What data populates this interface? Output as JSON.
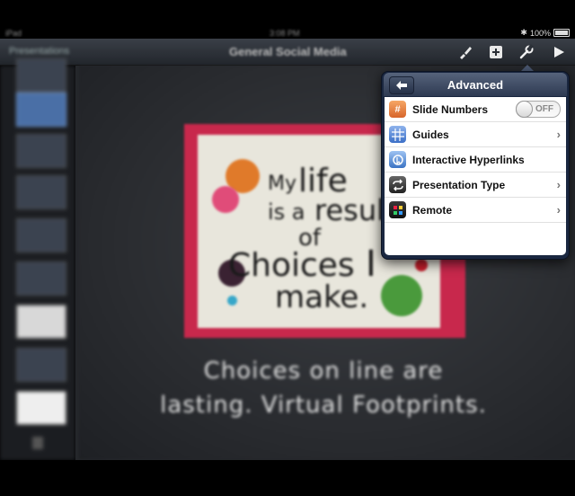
{
  "status_bar": {
    "carrier": "iPad",
    "time": "3:08 PM",
    "battery": "100%"
  },
  "toolbar": {
    "left_label": "Presentations",
    "title": "General Social Media"
  },
  "slide": {
    "quote_lines": [
      "My",
      "life",
      "is a",
      "result",
      "of",
      "Choices",
      "I",
      "make."
    ],
    "caption_line1": "Choices on line are",
    "caption_line2": "lasting. Virtual Footprints."
  },
  "popover": {
    "title": "Advanced",
    "rows": [
      {
        "label": "Slide Numbers",
        "icon": "slide-numbers-icon",
        "toggle": "OFF"
      },
      {
        "label": "Guides",
        "icon": "guides-icon"
      },
      {
        "label": "Interactive Hyperlinks",
        "icon": "hyperlink-icon"
      },
      {
        "label": "Presentation Type",
        "icon": "presentation-type-icon"
      },
      {
        "label": "Remote",
        "icon": "remote-icon"
      }
    ]
  },
  "colors": {
    "accent_pink": "#c8284c",
    "popover_header": "#3b4762"
  }
}
